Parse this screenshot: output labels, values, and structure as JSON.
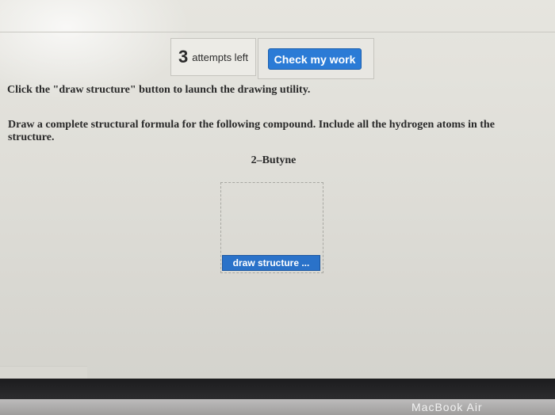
{
  "header": {
    "attempts_count": "3",
    "attempts_label": "attempts left",
    "check_button_label": "Check my work"
  },
  "question": {
    "instruction_launch": "Click the \"draw structure\" button to launch the drawing utility.",
    "instruction_draw": "Draw a complete structural formula for the following compound. Include all the hydrogen atoms in the structure.",
    "compound_name": "2–Butyne",
    "draw_button_label": "draw structure ..."
  },
  "device": {
    "brand_label": "MacBook Air"
  },
  "colors": {
    "primary_button": "#2b7bd6",
    "draw_button": "#2a72c9",
    "text": "#2a2a2a",
    "bezel": "#1c1c1e"
  }
}
